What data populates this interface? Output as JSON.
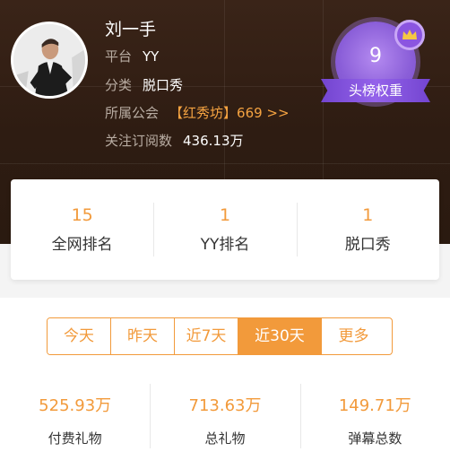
{
  "profile": {
    "name": "刘一手",
    "platform_label": "平台",
    "platform_value": "YY",
    "category_label": "分类",
    "category_value": "脱口秀",
    "guild_label": "所属公会",
    "guild_name": "【红秀坊】",
    "guild_number": "669 >>",
    "followers_label": "关注订阅数",
    "followers_value": "436.13万"
  },
  "badge": {
    "level": "9",
    "ribbon_text": "头榜权重",
    "color": "#8a5ed8",
    "icon": "crown-icon"
  },
  "ranks": [
    {
      "value": "15",
      "label": "全网排名"
    },
    {
      "value": "1",
      "label": "YY排名"
    },
    {
      "value": "1",
      "label": "脱口秀"
    }
  ],
  "tabs": [
    {
      "label": "今天",
      "active": false
    },
    {
      "label": "昨天",
      "active": false
    },
    {
      "label": "近7天",
      "active": false
    },
    {
      "label": "近30天",
      "active": true
    },
    {
      "label": "更多",
      "active": false
    }
  ],
  "stats": [
    {
      "value": "525.93万",
      "label": "付费礼物"
    },
    {
      "value": "713.63万",
      "label": "总礼物"
    },
    {
      "value": "149.71万",
      "label": "弹幕总数"
    }
  ],
  "colors": {
    "accent": "#f29a3b",
    "header_bg": "#2e1c12"
  }
}
